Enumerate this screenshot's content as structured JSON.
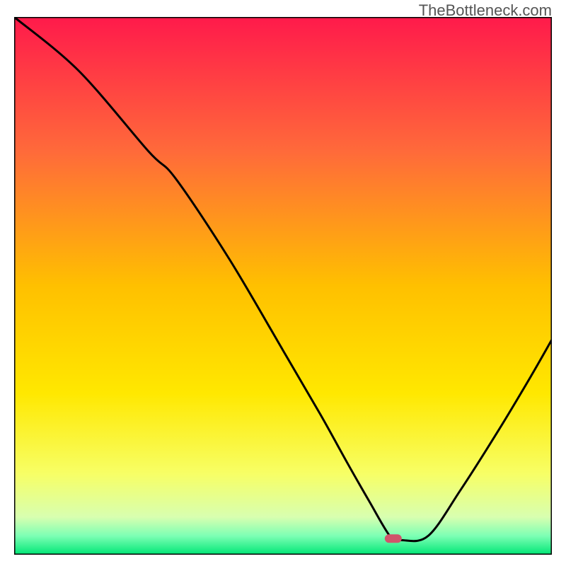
{
  "watermark": "TheBottleneck.com",
  "chart_data": {
    "type": "line",
    "title": "",
    "xlabel": "",
    "ylabel": "",
    "xlim": [
      0,
      100
    ],
    "ylim": [
      0,
      100
    ],
    "axes_visible": false,
    "grid": false,
    "legend": false,
    "background_gradient_stops": [
      {
        "pos": 0.0,
        "color": "#ff1a4b"
      },
      {
        "pos": 0.25,
        "color": "#ff6a3a"
      },
      {
        "pos": 0.5,
        "color": "#ffc000"
      },
      {
        "pos": 0.7,
        "color": "#ffe800"
      },
      {
        "pos": 0.85,
        "color": "#f7ff66"
      },
      {
        "pos": 0.93,
        "color": "#d8ffb0"
      },
      {
        "pos": 0.965,
        "color": "#7dffb4"
      },
      {
        "pos": 1.0,
        "color": "#00e676"
      }
    ],
    "series": [
      {
        "name": "bottleneck-curve",
        "marker": false,
        "x": [
          0.0,
          12.0,
          25.0,
          30.0,
          40.0,
          50.0,
          57.0,
          62.0,
          66.0,
          70.0,
          72.0,
          77.0,
          83.0,
          90.0,
          96.0,
          100.0
        ],
        "values": [
          100.0,
          90.0,
          75.0,
          70.0,
          55.0,
          38.0,
          26.0,
          17.0,
          10.0,
          3.3,
          2.7,
          3.5,
          12.0,
          23.0,
          33.0,
          40.0
        ]
      }
    ],
    "marker": {
      "name": "optimal-point",
      "x": 70.5,
      "y": 3.0,
      "color": "#d0546b",
      "note": "rounded pill marker at curve minimum"
    },
    "frame": {
      "stroke": "#000000",
      "stroke_width": 3
    }
  }
}
